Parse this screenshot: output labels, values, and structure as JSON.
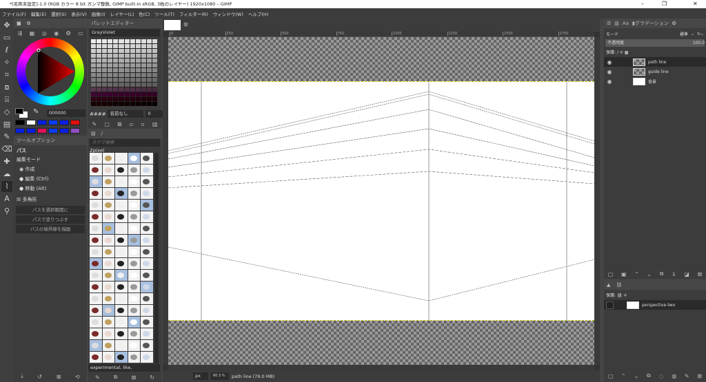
{
  "window": {
    "title": "*[名称未設定]-1.0 (RGB カラー 8 bit ガンマ整数, GIMP built-in sRGB, 3枚のレイヤー) 1920x1080 – GIMP",
    "minimize": "–",
    "maximize": "❐",
    "close": "✕"
  },
  "menu": [
    "ファイル(F)",
    "編集(E)",
    "選択(S)",
    "表示(V)",
    "画像(I)",
    "レイヤー(L)",
    "色(C)",
    "ツール(T)",
    "フィルター(R)",
    "ウィンドウ(W)",
    "ヘルプ(H)"
  ],
  "colors": {
    "fg": "#000000",
    "bg": "#ffffff",
    "hex": "000000",
    "history": [
      "#000000",
      "#ffffff",
      "#0a1ee0",
      "#0a3cf0",
      "#0a1ee0",
      "#e01010",
      "#0a1ee0",
      "#0a1ee0",
      "#e0105a",
      "#0a3cf0",
      "#0a1ee0",
      "#9050c0"
    ]
  },
  "tool_options": {
    "tab": "ツールオプション",
    "tool": "パス",
    "mode_label": "編集モード",
    "modes": [
      "作成",
      "編集 (Ctrl)",
      "移動 (Alt)"
    ],
    "polygon": "多角形",
    "buttons": [
      "パスを選択範囲に",
      "パスで塗りつぶす",
      "パスの境界線を描画"
    ]
  },
  "palette": {
    "tab": "パレットエディター",
    "name": "GrayViolet",
    "entry_hash": "####",
    "entry_name": "名前なし",
    "columns": "0"
  },
  "brushes": {
    "search_placeholder": "タグで検索",
    "current": "2pixel",
    "tags": "experimental, like,"
  },
  "canvas": {
    "ruler_ticks": [
      "0",
      "250",
      "500",
      "750",
      "1000",
      "1250",
      "1500",
      "1750"
    ],
    "unit": "px",
    "zoom": "60.3 %",
    "status": "path line (79.0 MB)"
  },
  "layers": {
    "tabs_label": "グラデーション",
    "mode_label": "モード",
    "mode_value": "標準",
    "opacity_label": "不透明度",
    "opacity_value": "100.0",
    "lock_label": "保護:",
    "items": [
      {
        "name": "path line",
        "selected": true
      },
      {
        "name": "guide line",
        "selected": false
      },
      {
        "name": "背景",
        "selected": false
      }
    ]
  },
  "paths": {
    "lock_label": "保護:",
    "items": [
      {
        "name": "perspective-two"
      }
    ]
  }
}
